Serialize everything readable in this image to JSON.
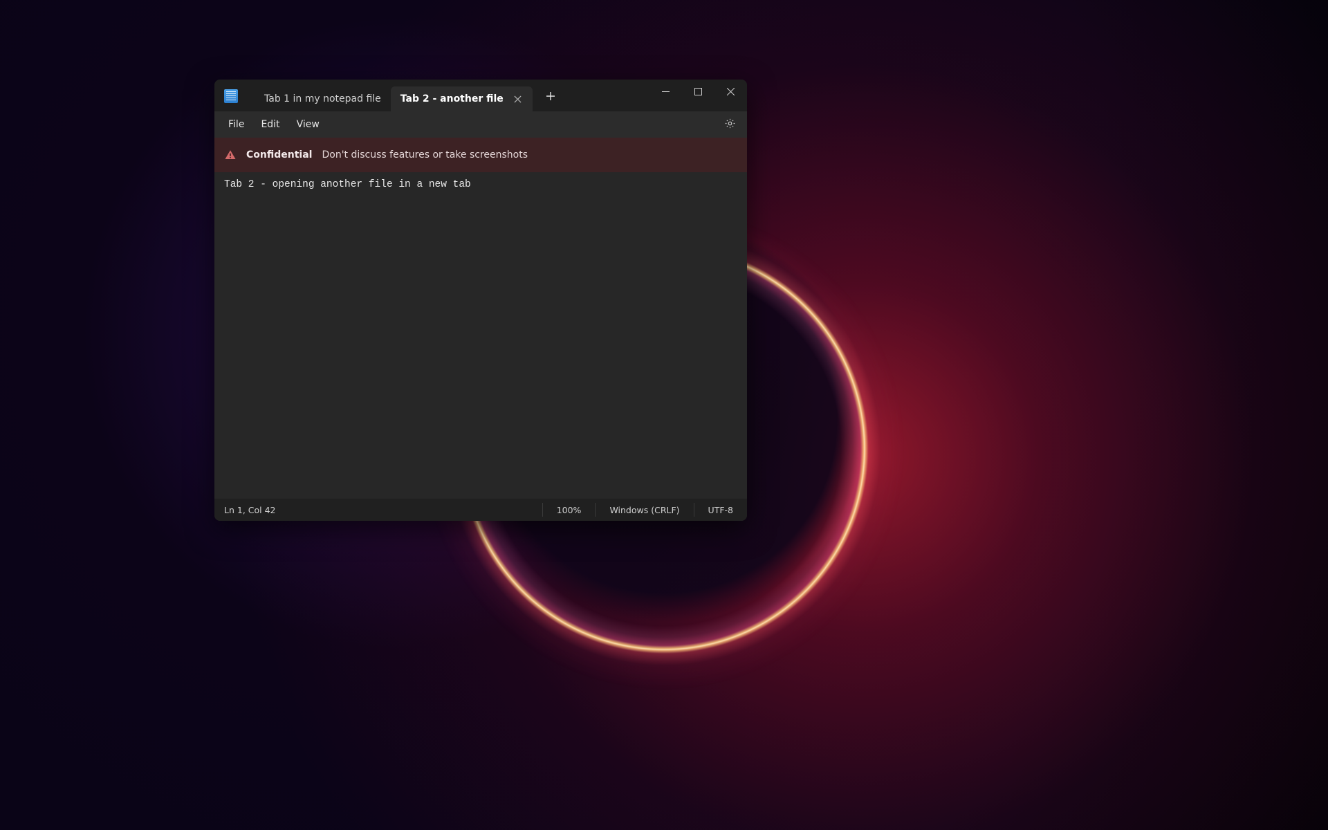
{
  "tabs": [
    {
      "label": "Tab 1 in my notepad file",
      "active": false
    },
    {
      "label": "Tab 2 - another file",
      "active": true
    }
  ],
  "menu": {
    "file": "File",
    "edit": "Edit",
    "view": "View"
  },
  "banner": {
    "title": "Confidential",
    "text": "Don't discuss features or take screenshots"
  },
  "editor": {
    "content": "Tab 2 - opening another file in a new tab"
  },
  "statusbar": {
    "position": "Ln 1, Col 42",
    "zoom": "100%",
    "line_ending": "Windows (CRLF)",
    "encoding": "UTF-8"
  }
}
